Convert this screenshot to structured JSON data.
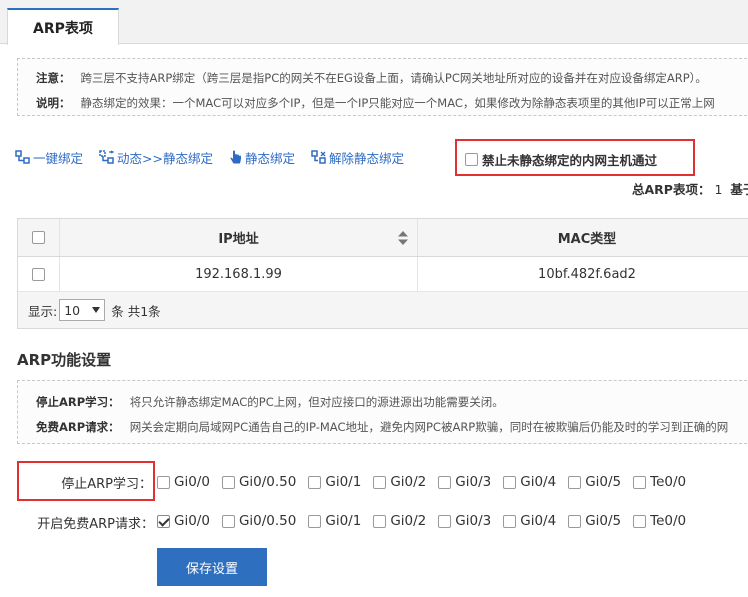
{
  "tab": {
    "label": "ARP表项"
  },
  "notes": [
    {
      "label": "注意：",
      "text": "跨三层不支持ARP绑定（跨三层是指PC的网关不在EG设备上面，请确认PC网关地址所对应的设备并在对应设备绑定ARP）。"
    },
    {
      "label": "说明：",
      "text": "静态绑定的效果：一个MAC可以对应多个IP，但是一个IP只能对应一个MAC，如果修改为除静态表项里的其他IP可以正常上网"
    }
  ],
  "toolbar": {
    "one_click_bind": "一键绑定",
    "dynamic_to_static": "动态>>静态绑定",
    "static_bind": "静态绑定",
    "unbind_static": "解除静态绑定",
    "forbid_label": "禁止未静态绑定的内网主机通过"
  },
  "total": {
    "label": "总ARP表项：",
    "count": "1",
    "suffix": "基于"
  },
  "table": {
    "headers": [
      "IP地址",
      "MAC类型"
    ],
    "rows": [
      {
        "ip": "192.168.1.99",
        "mac": "10bf.482f.6ad2"
      }
    ],
    "footer": {
      "show_label": "显示:",
      "page_size": "10",
      "summary": "条 共1条"
    }
  },
  "arp_settings": {
    "title": "ARP功能设置",
    "notes": [
      {
        "label": "停止ARP学习：",
        "text": "将只允许静态绑定MAC的PC上网，但对应接口的源进源出功能需要关闭。"
      },
      {
        "label": "免费ARP请求：",
        "text": "网关会定期向局域网PC通告自己的IP-MAC地址，避免内网PC被ARP欺骗，同时在被欺骗后仍能及时的学习到正确的网"
      }
    ],
    "stop_learning": {
      "label": "停止ARP学习：",
      "ports": [
        {
          "name": "Gi0/0",
          "checked": false
        },
        {
          "name": "Gi0/0.50",
          "checked": false
        },
        {
          "name": "Gi0/1",
          "checked": false
        },
        {
          "name": "Gi0/2",
          "checked": false
        },
        {
          "name": "Gi0/3",
          "checked": false
        },
        {
          "name": "Gi0/4",
          "checked": false
        },
        {
          "name": "Gi0/5",
          "checked": false
        },
        {
          "name": "Te0/0",
          "checked": false
        }
      ]
    },
    "gratuitous": {
      "label": "开启免费ARP请求：",
      "ports": [
        {
          "name": "Gi0/0",
          "checked": true
        },
        {
          "name": "Gi0/0.50",
          "checked": false
        },
        {
          "name": "Gi0/1",
          "checked": false
        },
        {
          "name": "Gi0/2",
          "checked": false
        },
        {
          "name": "Gi0/3",
          "checked": false
        },
        {
          "name": "Gi0/4",
          "checked": false
        },
        {
          "name": "Gi0/5",
          "checked": false
        },
        {
          "name": "Te0/0",
          "checked": false
        }
      ]
    },
    "save_label": "保存设置"
  },
  "colors": {
    "accent": "#2f6fbf",
    "link": "#2e6bc4",
    "highlight": "#e03030"
  }
}
